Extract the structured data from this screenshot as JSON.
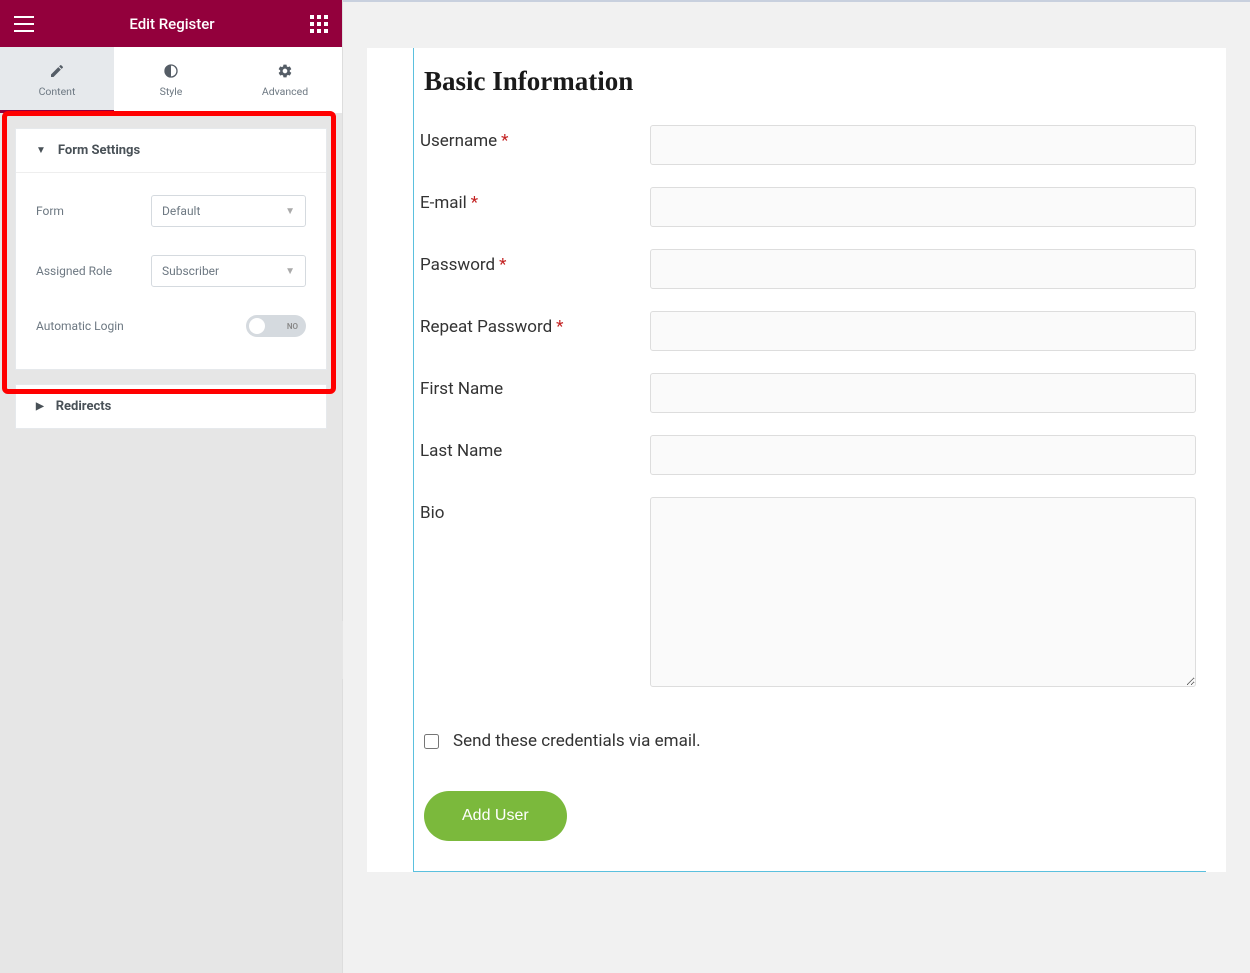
{
  "sidebar": {
    "title": "Edit Register",
    "tabs": [
      {
        "label": "Content"
      },
      {
        "label": "Style"
      },
      {
        "label": "Advanced"
      }
    ],
    "panels": {
      "formSettings": {
        "title": "Form Settings",
        "controls": {
          "form": {
            "label": "Form",
            "value": "Default"
          },
          "assignedRole": {
            "label": "Assigned Role",
            "value": "Subscriber"
          },
          "automaticLogin": {
            "label": "Automatic Login",
            "state": "NO"
          }
        }
      },
      "redirects": {
        "title": "Redirects"
      }
    }
  },
  "preview": {
    "heading": "Basic Information",
    "fields": {
      "username": {
        "label": "Username",
        "required": true
      },
      "email": {
        "label": "E-mail",
        "required": true
      },
      "password": {
        "label": "Password",
        "required": true
      },
      "repeatPassword": {
        "label": "Repeat Password",
        "required": true
      },
      "firstName": {
        "label": "First Name",
        "required": false
      },
      "lastName": {
        "label": "Last Name",
        "required": false
      },
      "bio": {
        "label": "Bio",
        "required": false
      }
    },
    "checkboxLabel": "Send these credentials via email.",
    "submitLabel": "Add User"
  }
}
